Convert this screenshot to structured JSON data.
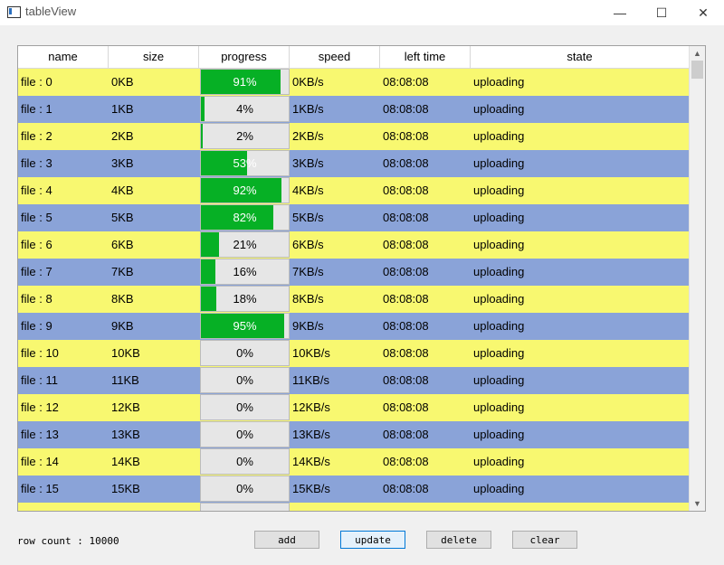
{
  "window": {
    "title": "tableView",
    "min_glyph": "—",
    "max_glyph": "☐",
    "close_glyph": "✕"
  },
  "table": {
    "columns": [
      "name",
      "size",
      "progress",
      "speed",
      "left time",
      "state"
    ],
    "rows": [
      {
        "name": "file : 0",
        "size": "0KB",
        "progress": "91%",
        "progress_value": 0.91,
        "speed": "0KB/s",
        "left_time": "08:08:08",
        "state": "uploading"
      },
      {
        "name": "file : 1",
        "size": "1KB",
        "progress": "4%",
        "progress_value": 0.04,
        "speed": "1KB/s",
        "left_time": "08:08:08",
        "state": "uploading"
      },
      {
        "name": "file : 2",
        "size": "2KB",
        "progress": "2%",
        "progress_value": 0.02,
        "speed": "2KB/s",
        "left_time": "08:08:08",
        "state": "uploading"
      },
      {
        "name": "file : 3",
        "size": "3KB",
        "progress": "53%",
        "progress_value": 0.53,
        "speed": "3KB/s",
        "left_time": "08:08:08",
        "state": "uploading"
      },
      {
        "name": "file : 4",
        "size": "4KB",
        "progress": "92%",
        "progress_value": 0.92,
        "speed": "4KB/s",
        "left_time": "08:08:08",
        "state": "uploading"
      },
      {
        "name": "file : 5",
        "size": "5KB",
        "progress": "82%",
        "progress_value": 0.82,
        "speed": "5KB/s",
        "left_time": "08:08:08",
        "state": "uploading"
      },
      {
        "name": "file : 6",
        "size": "6KB",
        "progress": "21%",
        "progress_value": 0.21,
        "speed": "6KB/s",
        "left_time": "08:08:08",
        "state": "uploading"
      },
      {
        "name": "file : 7",
        "size": "7KB",
        "progress": "16%",
        "progress_value": 0.16,
        "speed": "7KB/s",
        "left_time": "08:08:08",
        "state": "uploading"
      },
      {
        "name": "file : 8",
        "size": "8KB",
        "progress": "18%",
        "progress_value": 0.18,
        "speed": "8KB/s",
        "left_time": "08:08:08",
        "state": "uploading"
      },
      {
        "name": "file : 9",
        "size": "9KB",
        "progress": "95%",
        "progress_value": 0.95,
        "speed": "9KB/s",
        "left_time": "08:08:08",
        "state": "uploading"
      },
      {
        "name": "file : 10",
        "size": "10KB",
        "progress": "0%",
        "progress_value": 0.0,
        "speed": "10KB/s",
        "left_time": "08:08:08",
        "state": "uploading"
      },
      {
        "name": "file : 11",
        "size": "11KB",
        "progress": "0%",
        "progress_value": 0.0,
        "speed": "11KB/s",
        "left_time": "08:08:08",
        "state": "uploading"
      },
      {
        "name": "file : 12",
        "size": "12KB",
        "progress": "0%",
        "progress_value": 0.0,
        "speed": "12KB/s",
        "left_time": "08:08:08",
        "state": "uploading"
      },
      {
        "name": "file : 13",
        "size": "13KB",
        "progress": "0%",
        "progress_value": 0.0,
        "speed": "13KB/s",
        "left_time": "08:08:08",
        "state": "uploading"
      },
      {
        "name": "file : 14",
        "size": "14KB",
        "progress": "0%",
        "progress_value": 0.0,
        "speed": "14KB/s",
        "left_time": "08:08:08",
        "state": "uploading"
      },
      {
        "name": "file : 15",
        "size": "15KB",
        "progress": "0%",
        "progress_value": 0.0,
        "speed": "15KB/s",
        "left_time": "08:08:08",
        "state": "uploading"
      }
    ],
    "row_colors": [
      "#f8f870",
      "#8aa3d8"
    ],
    "progress_color": "#06b025"
  },
  "footer": {
    "row_count": "row count : 10000",
    "add_label": "add",
    "update_label": "update",
    "delete_label": "delete",
    "clear_label": "clear"
  }
}
